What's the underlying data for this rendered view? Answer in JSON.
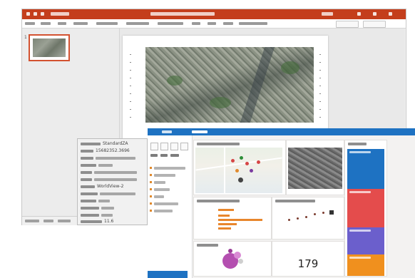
{
  "colors": {
    "ppt_accent": "#c43e1c",
    "pbi_accent": "#1e72c2",
    "selected_thumb": "#d35230",
    "bar_color": "#e8862c",
    "treemap": [
      "#1e72c2",
      "#e44c4c",
      "#6b5fcc",
      "#f0901e"
    ]
  },
  "powerpoint": {
    "slide_number": "1",
    "icons": [
      "undo-icon",
      "redo-icon",
      "save-icon",
      "minimize-icon",
      "maximize-icon",
      "close-icon"
    ]
  },
  "metadata_popup": {
    "product_label": "StandardZA",
    "sensor": "WorldView-2",
    "values": [
      "15682352.3696",
      "11.6"
    ]
  },
  "powerbi": {
    "kpi": {
      "value": "179"
    }
  }
}
